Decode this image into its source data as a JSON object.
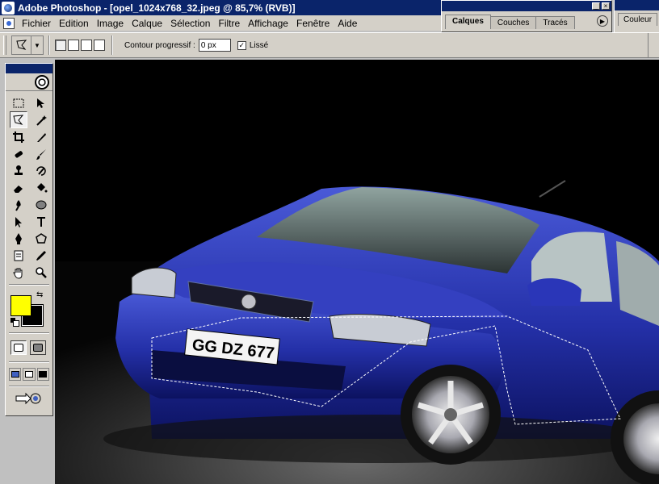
{
  "window": {
    "title": "Adobe Photoshop - [opel_1024x768_32.jpeg @ 85,7% (RVB)]"
  },
  "menubar": {
    "items": [
      "Fichier",
      "Edition",
      "Image",
      "Calque",
      "Sélection",
      "Filtre",
      "Affichage",
      "Fenêtre",
      "Aide"
    ]
  },
  "layers_palette": {
    "tabs": [
      "Calques",
      "Couches",
      "Tracés"
    ],
    "active_tab": "Calques"
  },
  "color_palette": {
    "tab": "Couleur"
  },
  "options_bar": {
    "feather_label": "Contour progressif :",
    "feather_value": "0 px",
    "antialias_label": "Lissé",
    "antialias_checked": true
  },
  "toolbox": {
    "active_tool": "polygonal-lasso",
    "foreground_color": "#ffff00",
    "background_color": "#000000"
  },
  "document": {
    "filename": "opel_1024x768_32.jpeg",
    "zoom": "85,7%",
    "mode": "RVB",
    "plate_text": "GG DZ 677",
    "car_color": "#2430a8"
  }
}
